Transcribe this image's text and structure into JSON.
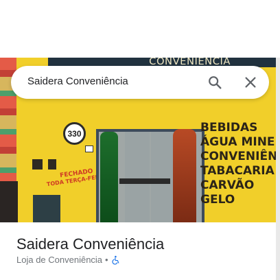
{
  "search": {
    "query": "Saidera Conveniência"
  },
  "photo": {
    "awning_text": "CONVENIÊNCIA",
    "address_number": "330",
    "storefront_sign_lines": [
      "BEBIDAS",
      "ÁGUA MINERAL",
      "CONVENIÊNCIA",
      "TABACARIA",
      "CARVÃO",
      "GELO"
    ],
    "fechado_text": "FECHADO",
    "fechado_sub": "TODA TERÇA-FEIRA!"
  },
  "place": {
    "name": "Saidera Conveniência",
    "category": "Loja de Conveniência",
    "separator": "•"
  },
  "icons": {
    "search": "search-icon",
    "close": "close-icon",
    "accessibility": "wheelchair-icon"
  },
  "colors": {
    "accent_blue": "#1a73e8",
    "wall_yellow": "#f1cf2a"
  }
}
